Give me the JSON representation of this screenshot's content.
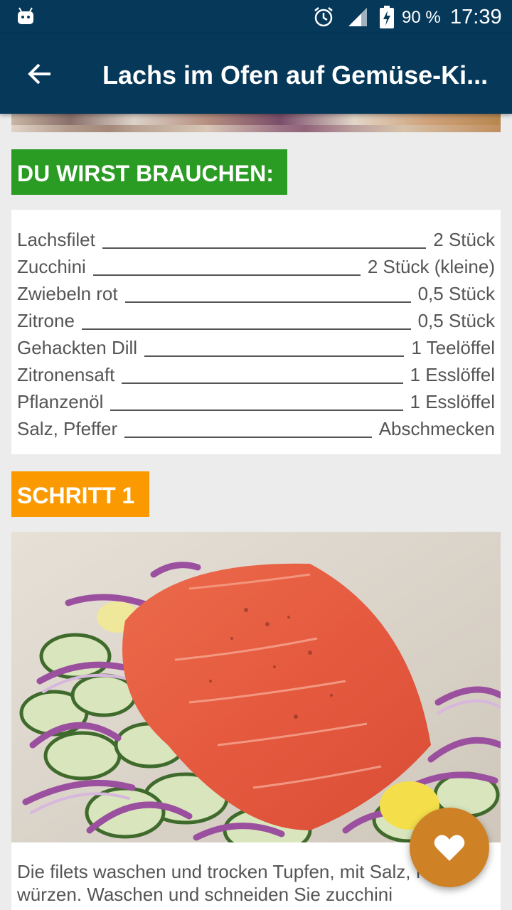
{
  "status_bar": {
    "battery": "90 %",
    "time": "17:39",
    "icons": [
      "android-icon",
      "alarm-icon",
      "signal-icon",
      "battery-charging-icon"
    ]
  },
  "app_bar": {
    "title": "Lachs im Ofen auf Gemüse-Ki...",
    "back_icon": "arrow-left-icon"
  },
  "ingredients": {
    "heading": "DU WIRST BRAUCHEN:",
    "items": [
      {
        "name": "Lachsfilet",
        "amount": "2 Stück"
      },
      {
        "name": "Zucchini",
        "amount": "2 Stück (kleine)"
      },
      {
        "name": "Zwiebeln rot",
        "amount": "0,5 Stück"
      },
      {
        "name": "Zitrone",
        "amount": "0,5 Stück"
      },
      {
        "name": "Gehackten Dill",
        "amount": "1 Teelöffel"
      },
      {
        "name": "Zitronensaft",
        "amount": "1 Esslöffel"
      },
      {
        "name": "Pflanzenöl",
        "amount": "1 Esslöffel"
      },
      {
        "name": "Salz, Pfeffer",
        "amount": "Abschmecken"
      }
    ]
  },
  "step": {
    "heading": "SCHRITT 1",
    "text": "Die filets waschen und trocken Tupfen, mit Salz, Pfeffer würzen. Waschen und schneiden Sie zucchini"
  },
  "fab": {
    "icon": "heart-icon"
  },
  "colors": {
    "app_bar": "#06385a",
    "ingredients_heading": "#2a9b23",
    "step_heading": "#fb9a00",
    "fab": "#cf8225"
  }
}
